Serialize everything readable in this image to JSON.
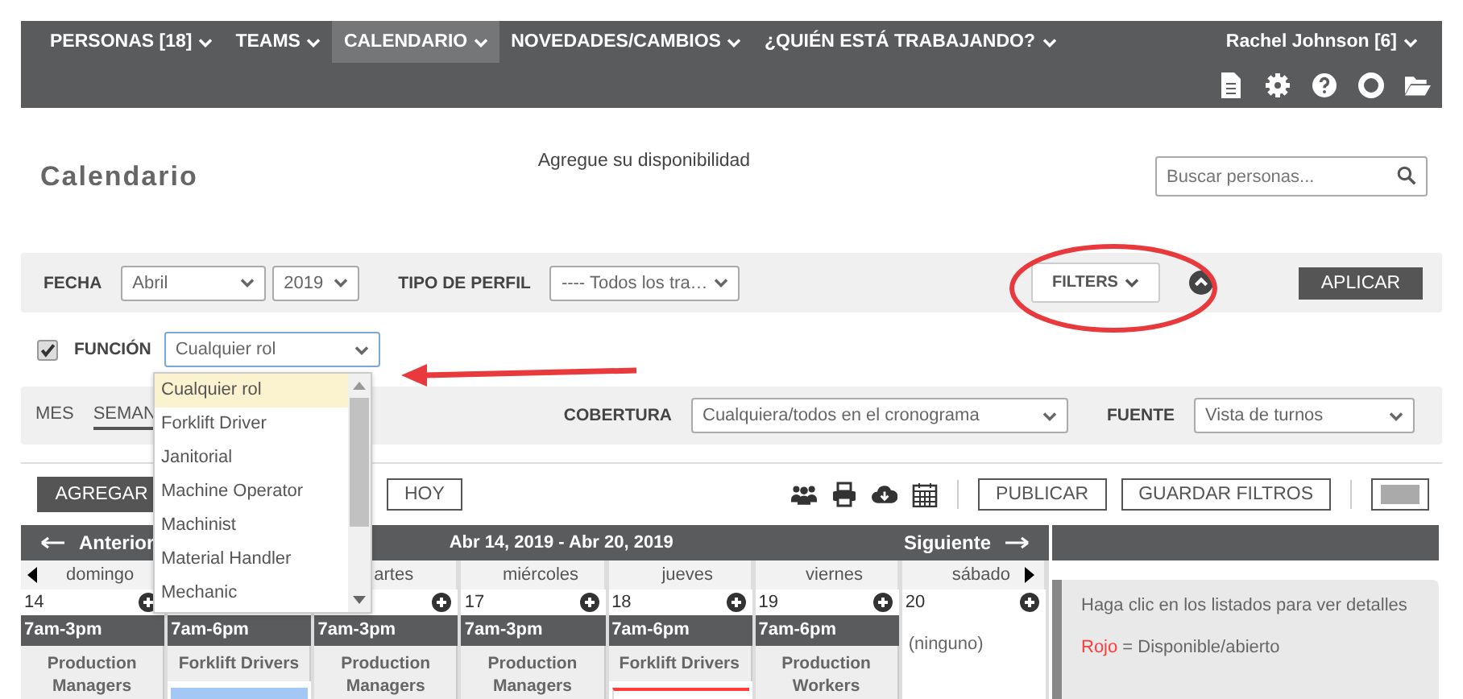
{
  "nav": {
    "items": [
      {
        "label": "PERSONAS [18]",
        "selected": false
      },
      {
        "label": "TEAMS",
        "selected": false
      },
      {
        "label": "CALENDARIO",
        "selected": true
      },
      {
        "label": "NOVEDADES/CAMBIOS",
        "selected": false
      },
      {
        "label": "¿QUIÉN ESTÁ TRABAJANDO?",
        "selected": false
      }
    ],
    "user": "Rachel Johnson [6]"
  },
  "header": {
    "title": "Calendario",
    "availability_link": "Agregue su disponibilidad",
    "search": {
      "placeholder": "Buscar personas..."
    }
  },
  "filters": {
    "date_label": "FECHA",
    "month": "Abril",
    "year": "2019",
    "profile_label": "TIPO DE PERFIL",
    "profile": "---- Todos los tra…",
    "filters_button": "FILTERS",
    "apply_button": "APLICAR"
  },
  "function_filter": {
    "checked": true,
    "label": "FUNCIÓN",
    "value": "Cualquier rol",
    "options": [
      {
        "label": "Cualquier rol",
        "selected": true
      },
      {
        "label": "Forklift Driver",
        "selected": false
      },
      {
        "label": "Janitorial",
        "selected": false
      },
      {
        "label": "Machine Operator",
        "selected": false
      },
      {
        "label": "Machinist",
        "selected": false
      },
      {
        "label": "Material Handler",
        "selected": false
      },
      {
        "label": "Mechanic",
        "selected": false
      }
    ]
  },
  "view": {
    "tabs": [
      {
        "label": "MES",
        "selected": false
      },
      {
        "label": "SEMAN",
        "selected": true
      }
    ],
    "coverage_label": "COBERTURA",
    "coverage": "Cualquiera/todos en el cronograma",
    "source_label": "FUENTE",
    "source": "Vista de turnos"
  },
  "toolbar": {
    "add_button": "AGREGAR",
    "today_button": "HOY",
    "publish_button": "PUBLICAR",
    "save_filters_button": "GUARDAR FILTROS"
  },
  "calendar": {
    "prev": "Anterior",
    "range": "Abr 14, 2019 - Abr 20, 2019",
    "next": "Siguiente",
    "days": [
      {
        "name": "domingo",
        "date": "14",
        "add_icon": true,
        "shifts": [
          {
            "time": "7am-3pm",
            "role": "Production Managers"
          }
        ]
      },
      {
        "shifts": [
          {
            "time": "7am-6pm",
            "role": "Forklift Drivers",
            "entries": [
              {
                "kind": "assigned"
              }
            ]
          }
        ]
      },
      {
        "name": "artes",
        "add_icon": true,
        "shifts": [
          {
            "time": "7am-3pm",
            "role": "Production Managers"
          }
        ]
      },
      {
        "name": "miércoles",
        "date": "17",
        "add_icon": true,
        "shifts": [
          {
            "time": "7am-3pm",
            "role": "Production Managers"
          }
        ]
      },
      {
        "name": "jueves",
        "date": "18",
        "add_icon": true,
        "shifts": [
          {
            "time": "7am-6pm",
            "role": "Forklift Drivers",
            "entries": [
              {
                "kind": "open"
              }
            ]
          }
        ]
      },
      {
        "name": "viernes",
        "date": "19",
        "add_icon": true,
        "shifts": [
          {
            "time": "7am-6pm",
            "role": "Production Workers"
          }
        ]
      },
      {
        "name": "sábado",
        "date": "20",
        "add_icon": true,
        "empty_text": "(ninguno)"
      }
    ]
  },
  "side_panel": {
    "hint": "Haga clic en los listados para ver detalles",
    "legend": [
      {
        "term": "Rojo",
        "color": "#ff3b3b",
        "meaning": "= Disponible/abierto"
      }
    ]
  }
}
